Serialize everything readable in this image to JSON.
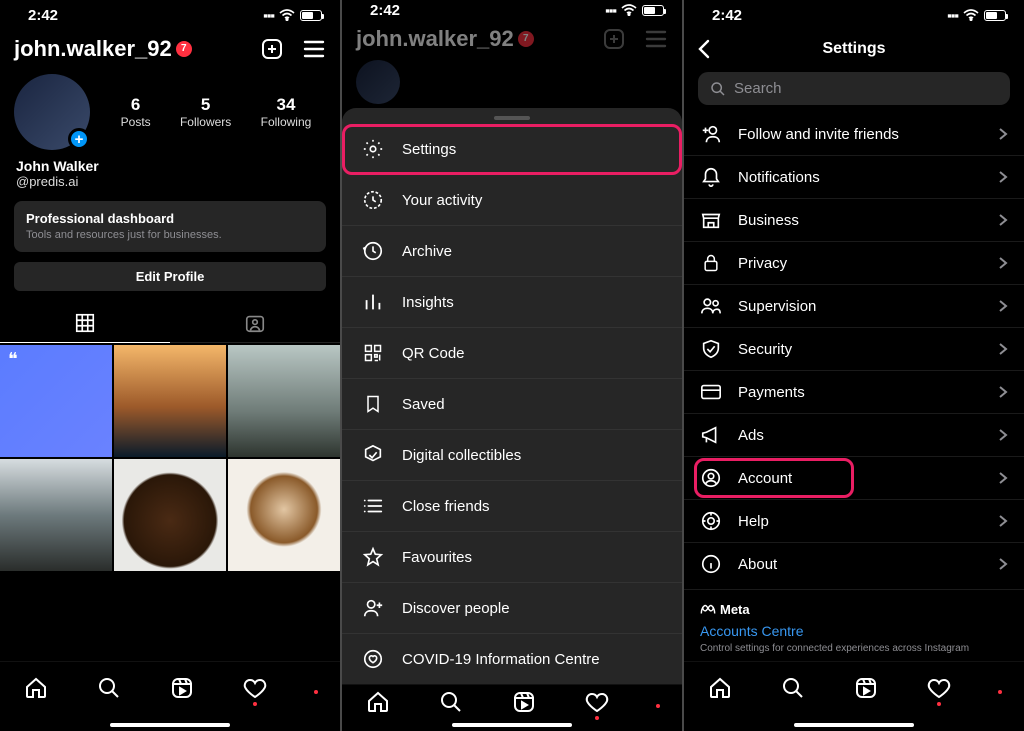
{
  "status": {
    "time": "2:42"
  },
  "profile": {
    "username": "john.walker_92",
    "badge_count": "7",
    "display_name": "John Walker",
    "handle": "@predis.ai",
    "stats": {
      "posts_num": "6",
      "posts_lbl": "Posts",
      "followers_num": "5",
      "followers_lbl": "Followers",
      "following_num": "34",
      "following_lbl": "Following"
    },
    "dashboard_title": "Professional dashboard",
    "dashboard_sub": "Tools and resources just for businesses.",
    "edit_profile": "Edit Profile"
  },
  "menu": {
    "items": [
      {
        "label": "Settings"
      },
      {
        "label": "Your activity"
      },
      {
        "label": "Archive"
      },
      {
        "label": "Insights"
      },
      {
        "label": "QR Code"
      },
      {
        "label": "Saved"
      },
      {
        "label": "Digital collectibles"
      },
      {
        "label": "Close friends"
      },
      {
        "label": "Favourites"
      },
      {
        "label": "Discover people"
      },
      {
        "label": "COVID-19 Information Centre"
      }
    ]
  },
  "settings": {
    "title": "Settings",
    "search_placeholder": "Search",
    "items": [
      {
        "label": "Follow and invite friends"
      },
      {
        "label": "Notifications"
      },
      {
        "label": "Business"
      },
      {
        "label": "Privacy"
      },
      {
        "label": "Supervision"
      },
      {
        "label": "Security"
      },
      {
        "label": "Payments"
      },
      {
        "label": "Ads"
      },
      {
        "label": "Account"
      },
      {
        "label": "Help"
      },
      {
        "label": "About"
      }
    ],
    "meta_brand": "Meta",
    "accounts_centre": "Accounts Centre",
    "accounts_sub": "Control settings for connected experiences across Instagram"
  }
}
